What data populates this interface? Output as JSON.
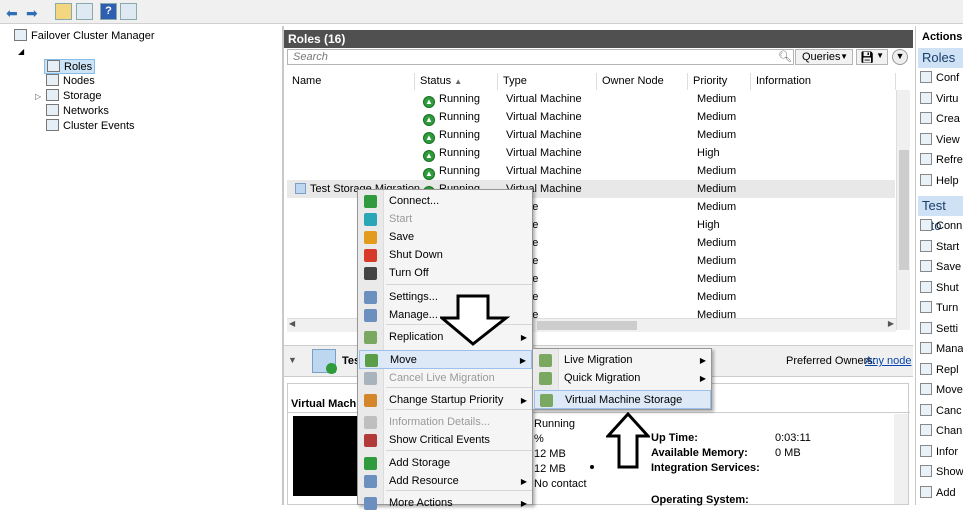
{
  "tree": {
    "root": "Failover Cluster Manager",
    "items": [
      "Roles",
      "Nodes",
      "Storage",
      "Networks",
      "Cluster Events"
    ]
  },
  "roles": {
    "title": "Roles (16)",
    "search_placeholder": "Search",
    "queries_label": "Queries",
    "columns": [
      "Name",
      "Status",
      "Type",
      "Owner Node",
      "Priority",
      "Information"
    ],
    "rows": [
      {
        "name": "",
        "status": "Running",
        "type": "Virtual Machine",
        "priority": "Medium"
      },
      {
        "name": "",
        "status": "Running",
        "type": "Virtual Machine",
        "priority": "Medium"
      },
      {
        "name": "",
        "status": "Running",
        "type": "Virtual Machine",
        "priority": "Medium"
      },
      {
        "name": "",
        "status": "Running",
        "type": "Virtual Machine",
        "priority": "High"
      },
      {
        "name": "",
        "status": "Running",
        "type": "Virtual Machine",
        "priority": "Medium"
      },
      {
        "name": "Test Storage Migration",
        "status": "Running",
        "type": "Virtual Machine",
        "priority": "Medium"
      },
      {
        "name": "",
        "status": "",
        "type": "achine",
        "priority": "Medium"
      },
      {
        "name": "",
        "status": "",
        "type": "achine",
        "priority": "High"
      },
      {
        "name": "",
        "status": "",
        "type": "achine",
        "priority": "Medium"
      },
      {
        "name": "",
        "status": "",
        "type": "achine",
        "priority": "Medium"
      },
      {
        "name": "",
        "status": "",
        "type": "achine",
        "priority": "Medium"
      },
      {
        "name": "",
        "status": "",
        "type": "achine",
        "priority": "Medium"
      },
      {
        "name": "",
        "status": "",
        "type": "achine",
        "priority": "Medium"
      }
    ]
  },
  "detail": {
    "vm_name_partial": "Tes",
    "preferred_owners_label": "Preferred Owners:",
    "preferred_owners_value": "Any node",
    "tab_label": "Virtual Machin",
    "left_values": [
      "Running",
      "%",
      "12 MB",
      "12 MB",
      "No contact"
    ],
    "uptime_label": "Up Time:",
    "uptime_value": "0:03:11",
    "avail_mem_label": "Available Memory:",
    "avail_mem_value": "0 MB",
    "integration_label": "Integration Services:",
    "os_label": "Operating System:"
  },
  "context_menu": {
    "items": [
      {
        "label": "Connect...",
        "disabled": false,
        "icon_color": "#2f9a3e"
      },
      {
        "label": "Start",
        "disabled": true,
        "icon_color": "#2aa7b7"
      },
      {
        "label": "Save",
        "disabled": false,
        "icon_color": "#e39b1c"
      },
      {
        "label": "Shut Down",
        "disabled": false,
        "icon_color": "#d83a2a"
      },
      {
        "label": "Turn Off",
        "disabled": false,
        "icon_color": "#444444"
      },
      {
        "label": "Settings...",
        "disabled": false,
        "icon_color": "#6b8fbf"
      },
      {
        "label": "Manage...",
        "disabled": false,
        "icon_color": "#6b8fbf"
      },
      {
        "label": "Replication",
        "disabled": false,
        "icon_color": "#7aa860",
        "submenu": true
      },
      {
        "label": "Move",
        "disabled": false,
        "icon_color": "#5b9e4a",
        "submenu": true,
        "highlight": true
      },
      {
        "label": "Cancel Live Migration",
        "disabled": true,
        "icon_color": "#a9b3bd"
      },
      {
        "label": "Change Startup Priority",
        "disabled": false,
        "icon_color": "#d4862b",
        "submenu": true
      },
      {
        "label": "Information Details...",
        "disabled": true,
        "icon_color": "#bfbfbf"
      },
      {
        "label": "Show Critical Events",
        "disabled": false,
        "icon_color": "#b33a3a"
      },
      {
        "label": "Add Storage",
        "disabled": false,
        "icon_color": "#2f9a3e"
      },
      {
        "label": "Add Resource",
        "disabled": false,
        "icon_color": "#6b8fbf",
        "submenu": true
      },
      {
        "label": "More Actions",
        "disabled": false,
        "icon_color": "#6b8fbf",
        "submenu": true
      }
    ]
  },
  "move_submenu": {
    "items": [
      {
        "label": "Live Migration",
        "submenu": true
      },
      {
        "label": "Quick Migration",
        "submenu": true
      },
      {
        "label": "Virtual Machine Storage",
        "submenu": false,
        "highlight": true
      }
    ]
  },
  "actions": {
    "title": "Actions",
    "section1": "Roles",
    "section1_items": [
      "Conf",
      "Virtu",
      "Crea",
      "View",
      "Refre",
      "Help"
    ],
    "section2": "Test Sto",
    "section2_items": [
      "Conn",
      "Start",
      "Save",
      "Shut",
      "Turn",
      "Setti",
      "Mana",
      "Repl",
      "Move",
      "Canc",
      "Chan",
      "Infor",
      "Show",
      "Add"
    ]
  }
}
